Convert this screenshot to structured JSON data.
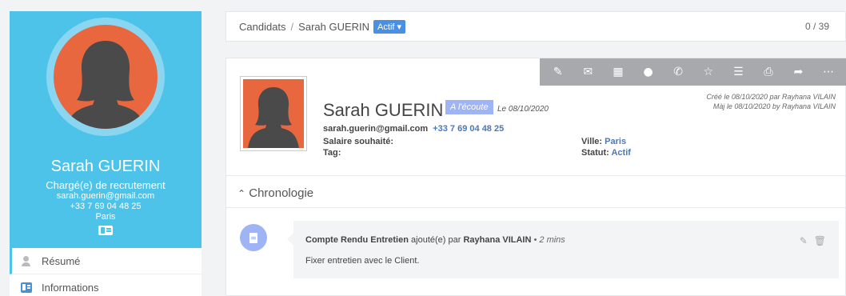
{
  "profile": {
    "name": "Sarah GUERIN",
    "role": "Chargé(e) de recrutement",
    "email": "sarah.guerin@gmail.com",
    "phone": "+33 7 69 04 48 25",
    "city": "Paris"
  },
  "menu": [
    {
      "label": "Résumé"
    },
    {
      "label": "Informations"
    }
  ],
  "breadcrumb": {
    "root": "Candidats",
    "separator": "/",
    "current": "Sarah GUERIN",
    "status_badge": "Actif ▾",
    "count": "0 / 39"
  },
  "toolbar": {
    "icons": [
      "edit-icon",
      "mail-icon",
      "calendar-icon",
      "comment-icon",
      "phone-icon",
      "star-icon",
      "checklist-icon",
      "print-icon",
      "share-icon",
      "more-icon"
    ]
  },
  "candidate": {
    "name": "Sarah GUERIN",
    "status_badge": "A l'écoute",
    "date": "Le 08/10/2020",
    "email": "sarah.guerin@gmail.com",
    "phone": "+33 7 69 04 48 25",
    "salary_label": "Salaire souhaité:",
    "salary_value": "",
    "tag_label": "Tag:",
    "tag_value": "",
    "city_label": "Ville:",
    "city_value": "Paris",
    "status_label": "Statut:",
    "status_value": "Actif",
    "created": "Créé le 08/10/2020 par Rayhana VILAIN",
    "modified": "Màj le 08/10/2020 by Rayhana VILAIN"
  },
  "chronology": {
    "title": "Chronologie",
    "entry": {
      "type": "Compte Rendu Entretien",
      "added_by_text": "ajouté(e) par",
      "author": "Rayhana VILAIN",
      "time": "• 2 mins",
      "body": "Fixer entretien avec le Client."
    }
  },
  "colors": {
    "profile_bg": "#4dc3ea",
    "avatar_bg": "#e8673f",
    "accent_blue": "#4a90e2",
    "badge_ecoute": "#9fb4f5",
    "toolbar_bg": "#a7a9ad"
  }
}
